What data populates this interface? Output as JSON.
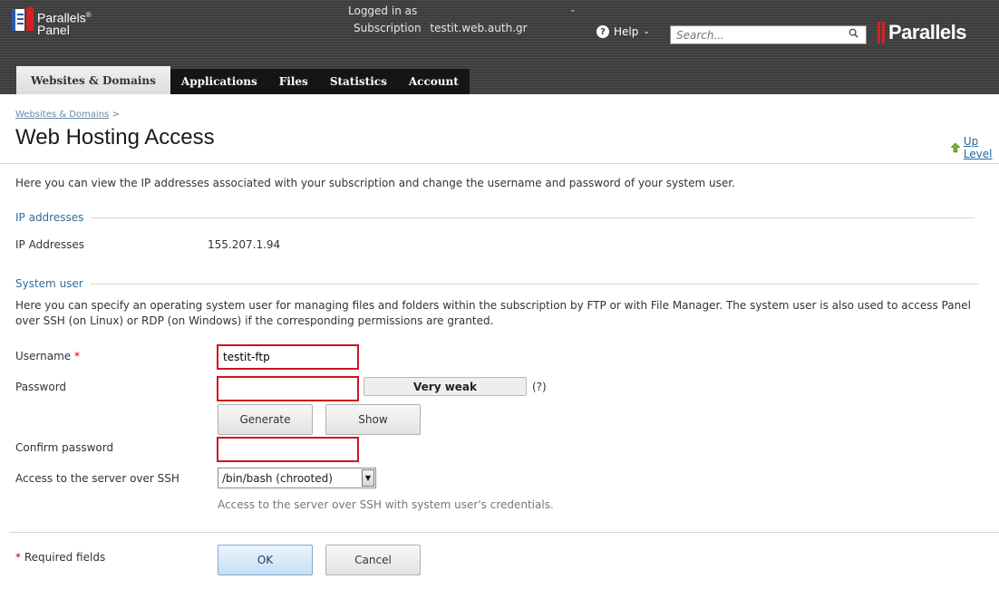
{
  "header": {
    "logo_line1": "Parallels",
    "logo_line2": "Panel",
    "logged_in_label": "Logged in as",
    "logged_in_user": "",
    "subscription_label": "Subscription",
    "subscription_value": "testit.web.auth.gr",
    "help_label": "Help",
    "search_placeholder": "Search...",
    "brand": "Parallels"
  },
  "tabs": [
    {
      "label": "Websites & Domains",
      "active": true
    },
    {
      "label": "Applications"
    },
    {
      "label": "Files"
    },
    {
      "label": "Statistics"
    },
    {
      "label": "Account"
    }
  ],
  "breadcrumb": {
    "link": "Websites & Domains",
    "separator": ">"
  },
  "page": {
    "title": "Web Hosting Access",
    "up_level": "Up Level",
    "intro": "Here you can view the IP addresses associated with your subscription and change the username and password of your system user."
  },
  "ip_section": {
    "title": "IP addresses",
    "label": "IP Addresses",
    "value": "155.207.1.94"
  },
  "system_user": {
    "title": "System user",
    "description": "Here you can specify an operating system user for managing files and folders within the subscription by FTP or with File Manager. The system user is also used to access Panel over SSH (on Linux) or RDP (on Windows) if the corresponding permissions are granted.",
    "username_label": "Username",
    "username_value": "testit-ftp",
    "password_label": "Password",
    "password_value": "",
    "strength": "Very weak",
    "strength_help": "(?)",
    "generate_label": "Generate",
    "show_label": "Show",
    "confirm_label": "Confirm password",
    "confirm_value": "",
    "ssh_label": "Access to the server over SSH",
    "ssh_selected": "/bin/bash (chrooted)",
    "ssh_hint": "Access to the server over SSH with system user's credentials."
  },
  "footer": {
    "required_mark": "*",
    "required_text": "Required fields",
    "ok_label": "OK",
    "cancel_label": "Cancel"
  },
  "colors": {
    "accent": "#2f6f98",
    "highlight_border": "#d2121e",
    "required": "#cc0000",
    "brand_red": "#d42127"
  }
}
